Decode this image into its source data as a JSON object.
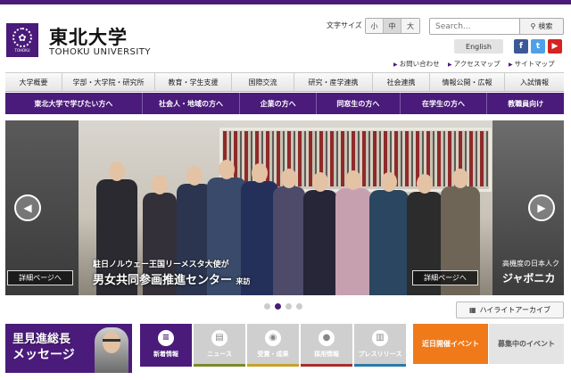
{
  "header": {
    "logo_jp": "東北大学",
    "logo_en": "TOHOKU UNIVERSITY",
    "fontsize_label": "文字サイズ",
    "fontsize_options": [
      "小",
      "中",
      "大"
    ],
    "search_placeholder": "Search...",
    "search_button": "検索",
    "english_button": "English",
    "social": {
      "facebook": "f",
      "twitter": "t",
      "youtube": "▶"
    },
    "utility_links": [
      "お問い合わせ",
      "アクセスマップ",
      "サイトマップ"
    ]
  },
  "main_nav": [
    "大学概要",
    "学部・大学院・研究所",
    "教育・学生支援",
    "国際交流",
    "研究・産学連携",
    "社会連携",
    "情報公開・広報",
    "入試情報"
  ],
  "audience_nav": [
    "東北大学で学びたい方へ",
    "社会人・地域の方へ",
    "企業の方へ",
    "同窓生の方へ",
    "在学生の方へ",
    "教職員向け"
  ],
  "hero": {
    "caption_line1": "駐日ノルウェー王国リーメスタ大使が",
    "caption_line2": "男女共同参画推進センター",
    "caption_suffix": "来訪",
    "detail_left": "詳細ページへ",
    "detail_right": "詳細ページへ",
    "right_caption1": "高機度の日本人ク",
    "right_caption2": "ジャボニカ",
    "prev_arrow": "◀",
    "next_arrow": "▶"
  },
  "highlight_archive": "ハイライトアーカイブ",
  "president": {
    "line1": "里見進総長",
    "line2": "メッセージ"
  },
  "tabs": [
    {
      "label": "新着情報",
      "icon": "≡",
      "bar_color": "#4a1b7a"
    },
    {
      "label": "ニュース",
      "icon": "▤",
      "bar_color": "#7a8a2a"
    },
    {
      "label": "受賞・成果",
      "icon": "◉",
      "bar_color": "#c6a12b"
    },
    {
      "label": "採用情報",
      "icon": "●",
      "bar_color": "#a82d2d"
    },
    {
      "label": "プレスリリース",
      "icon": "▥",
      "bar_color": "#2a7aa8"
    }
  ],
  "events": {
    "current": "近日開催イベント",
    "ongoing": "募集中のイベント"
  },
  "colors": {
    "brand_purple": "#4a1b7a",
    "event_orange": "#f07a1a"
  }
}
